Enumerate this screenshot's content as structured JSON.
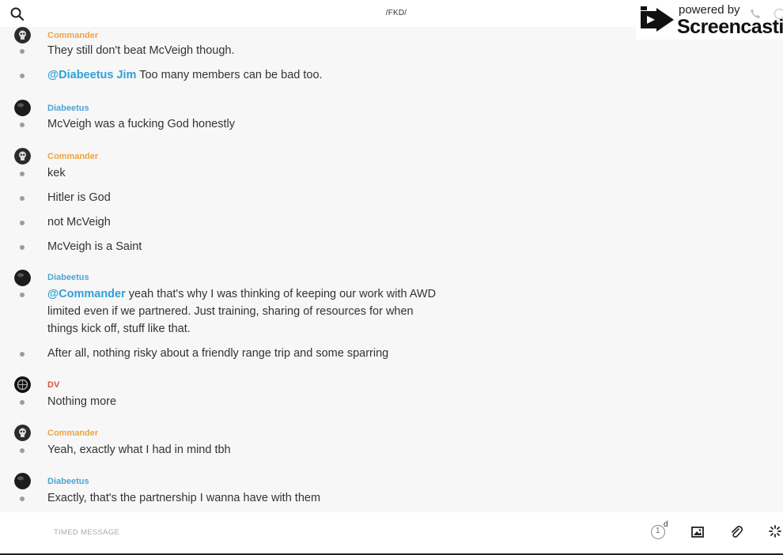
{
  "header": {
    "channel_title": "/FKD/",
    "search_icon": "search-icon"
  },
  "watermark": {
    "powered": "powered by",
    "brand": "Screencastify"
  },
  "messages": [
    {
      "sender": "Commander",
      "color": "#f0a340",
      "avatar": "skull-avatar",
      "lines": [
        {
          "text": "They still don't beat McVeigh though."
        },
        {
          "mention": "@Diabeetus Jim",
          "text": " Too many members can be bad too."
        }
      ]
    },
    {
      "sender": "Diabeetus",
      "color": "#4aa6d4",
      "avatar": "dark-avatar",
      "lines": [
        {
          "text": "McVeigh was a fucking God honestly"
        }
      ]
    },
    {
      "sender": "Commander",
      "color": "#f0a340",
      "avatar": "skull-avatar",
      "lines": [
        {
          "text": "kek"
        },
        {
          "text": "Hitler is God"
        },
        {
          "text": "not McVeigh"
        },
        {
          "text": "McVeigh is a Saint"
        }
      ]
    },
    {
      "sender": "Diabeetus",
      "color": "#4aa6d4",
      "avatar": "dark-avatar",
      "lines": [
        {
          "mention": "@Commander",
          "text": " yeah that's why I was thinking of keeping our work with AWD",
          "cont": [
            "limited even if we partnered. Just training, sharing of resources for when",
            "things kick off, stuff like that."
          ]
        },
        {
          "text": "After all, nothing risky about a friendly range trip and some sparring"
        }
      ]
    },
    {
      "sender": "DV",
      "color": "#e0533d",
      "avatar": "dv-avatar",
      "lines": [
        {
          "text": "Nothing more"
        }
      ]
    },
    {
      "sender": "Commander",
      "color": "#f0a340",
      "avatar": "skull-avatar",
      "lines": [
        {
          "text": "Yeah, exactly what I had in mind tbh"
        }
      ]
    },
    {
      "sender": "Diabeetus",
      "color": "#4aa6d4",
      "avatar": "dark-avatar",
      "lines": [
        {
          "text": "Exactly, that's the partnership I wanna have with them"
        }
      ]
    }
  ],
  "composer": {
    "timed_label": "TIMED MESSAGE",
    "timer_value": "1",
    "timer_unit": "d",
    "icons": [
      "timer-icon",
      "image-icon",
      "attachment-icon",
      "loading-icon"
    ]
  }
}
